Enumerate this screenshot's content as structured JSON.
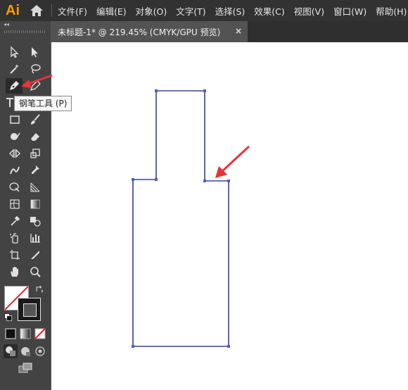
{
  "app": {
    "logo": "Ai"
  },
  "menu": [
    "文件(F)",
    "编辑(E)",
    "对象(O)",
    "文字(T)",
    "选择(S)",
    "效果(C)",
    "视图(V)",
    "窗口(W)",
    "帮助(H)"
  ],
  "document_tab": {
    "label": "未标题-1* @ 219.45% (CMYK/GPU 预览)",
    "close": "×"
  },
  "tooltip": {
    "text": "钢笔工具 (P)"
  },
  "panel": {
    "collapse": "◂◂"
  },
  "colors": {
    "accent_logo": "#ff9a00",
    "path_selection": "#4a5fd0",
    "annotation_arrow": "#e8323a"
  },
  "tools": [
    "selection-tool",
    "direct-selection-tool",
    "magic-wand-tool",
    "lasso-tool",
    "pen-tool",
    "curvature-tool",
    "type-tool",
    "line-segment-tool",
    "rectangle-tool",
    "paintbrush-tool",
    "shaper-tool",
    "eraser-tool",
    "rotate-tool",
    "scale-tool",
    "warp-tool",
    "free-transform-tool",
    "shape-builder-tool",
    "perspective-grid-tool",
    "mesh-tool",
    "gradient-tool",
    "eyedropper-tool",
    "blend-tool",
    "symbol-sprayer-tool",
    "column-graph-tool",
    "artboard-tool",
    "slice-tool",
    "hand-tool",
    "zoom-tool"
  ]
}
